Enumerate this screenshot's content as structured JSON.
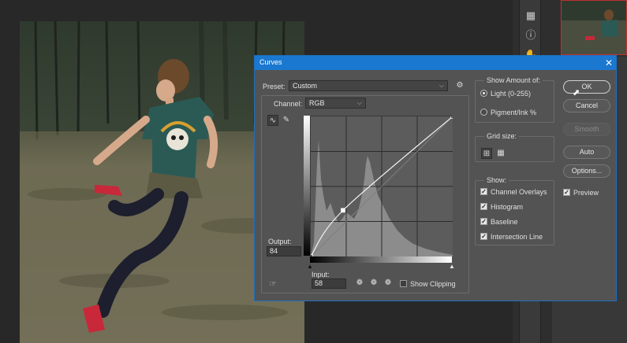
{
  "dialog": {
    "title": "Curves",
    "preset_label": "Preset:",
    "preset_value": "Custom",
    "channel_label": "Channel:",
    "channel_value": "RGB",
    "output_label": "Output:",
    "output_value": "84",
    "input_label": "Input:",
    "input_value": "58",
    "show_clipping_label": "Show Clipping",
    "show_clipping_checked": false
  },
  "show_amount": {
    "title": "Show Amount of:",
    "options": [
      {
        "label": "Light  (0-255)",
        "selected": true
      },
      {
        "label": "Pigment/Ink %",
        "selected": false
      }
    ]
  },
  "grid_size": {
    "title": "Grid size:"
  },
  "show": {
    "title": "Show:",
    "items": [
      {
        "label": "Channel Overlays",
        "checked": true
      },
      {
        "label": "Histogram",
        "checked": true
      },
      {
        "label": "Baseline",
        "checked": true
      },
      {
        "label": "Intersection Line",
        "checked": true
      }
    ]
  },
  "buttons": {
    "ok": "OK",
    "cancel": "Cancel",
    "smooth": "Smooth",
    "auto": "Auto",
    "options": "Options...",
    "preview": "Preview",
    "preview_checked": true
  },
  "curve": {
    "points": [
      [
        0,
        0
      ],
      [
        58,
        84
      ],
      [
        255,
        255
      ]
    ]
  },
  "colors": {
    "titlebar": "#1b78d0",
    "dialog_bg": "#535353"
  }
}
